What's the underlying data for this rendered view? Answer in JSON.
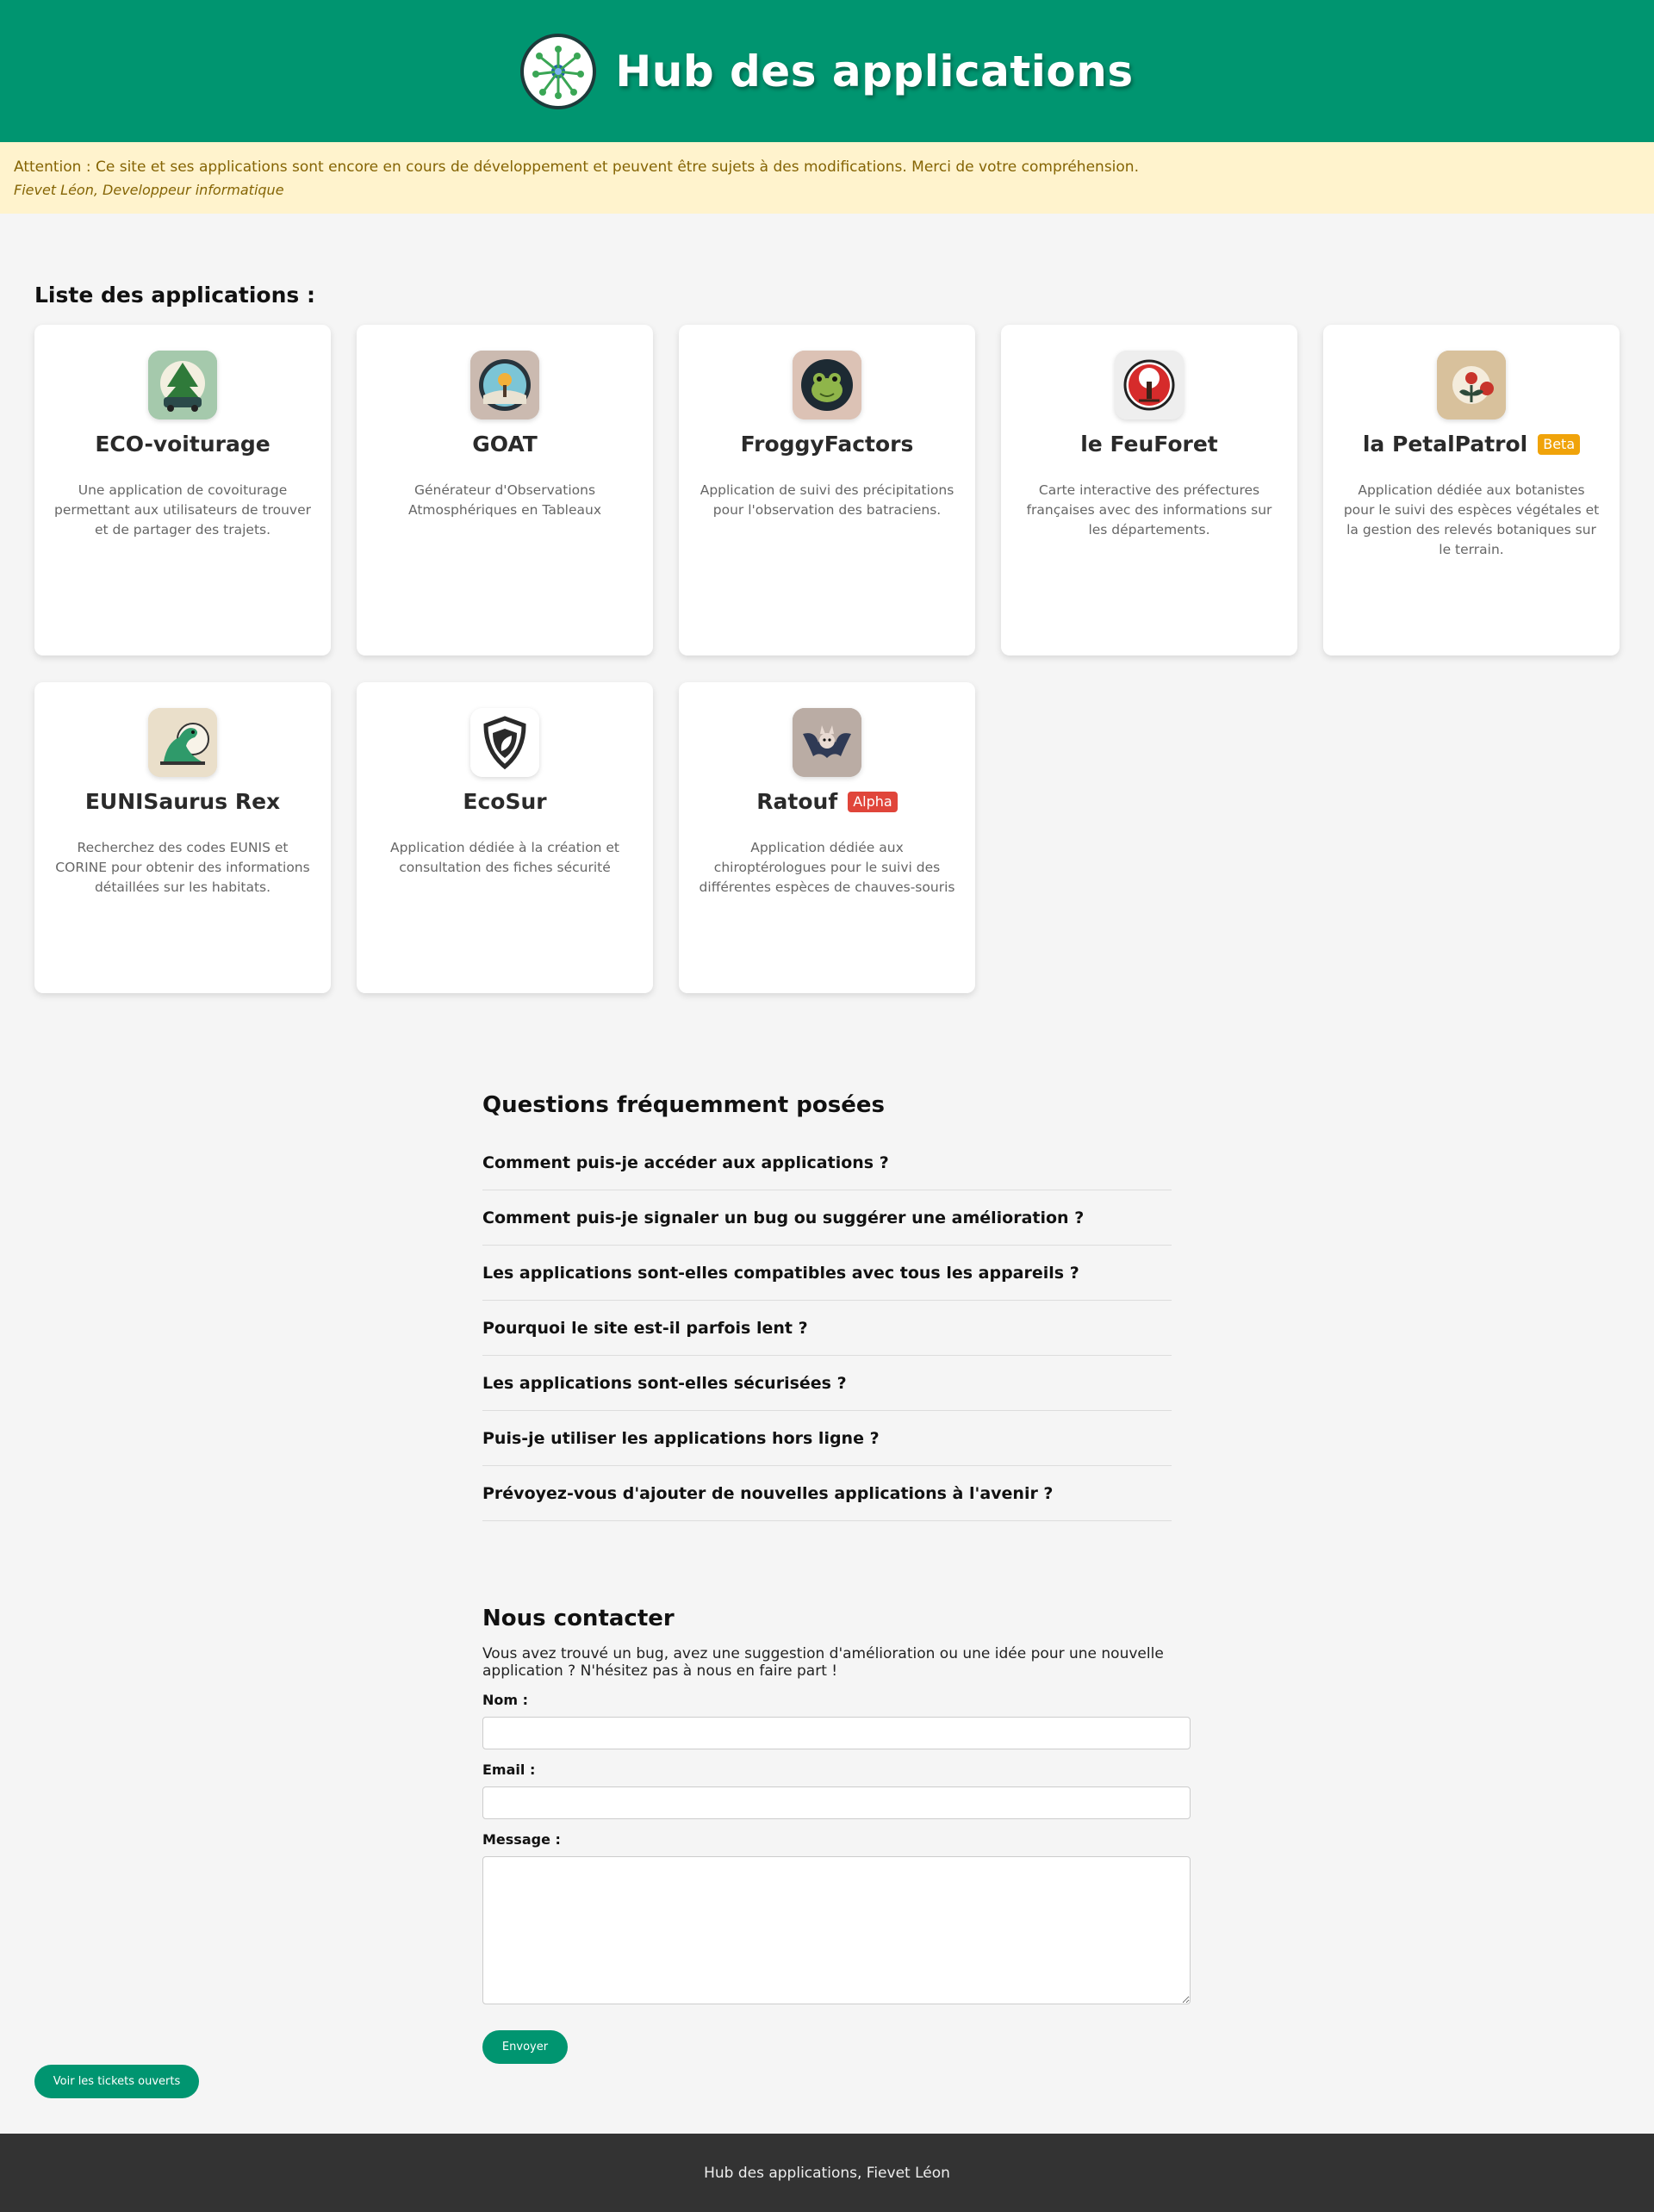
{
  "header": {
    "title": "Hub des applications",
    "logo_icon": "network-tree-icon"
  },
  "notice": {
    "message": "Attention : Ce site et ses applications sont encore en cours de développement et peuvent être sujets à des modifications. Merci de votre compréhension.",
    "signature": "Fievet Léon, Developpeur informatique"
  },
  "apps": {
    "section_title": "Liste des applications :",
    "items": [
      {
        "name": "ECO-voiturage",
        "description": "Une application de covoiturage permettant aux utilisateurs de trouver et de partager des trajets.",
        "icon": "tree-car-icon",
        "badge": ""
      },
      {
        "name": "GOAT",
        "description": "Générateur d'Observations Atmosphériques en Tableaux",
        "icon": "weather-landscape-icon",
        "badge": ""
      },
      {
        "name": "FroggyFactors",
        "description": "Application de suivi des précipitations pour l'observation des batraciens.",
        "icon": "frog-icon",
        "badge": ""
      },
      {
        "name": "le FeuForet",
        "description": "Carte interactive des préfectures françaises avec des informations sur les départements.",
        "icon": "red-tree-icon",
        "badge": ""
      },
      {
        "name": "la PetalPatrol",
        "description": "Application dédiée aux botanistes pour le suivi des espèces végétales et la gestion des relevés botaniques sur le terrain.",
        "icon": "flower-icon",
        "badge": "Beta"
      },
      {
        "name": "EUNISaurus Rex",
        "description": "Recherchez des codes EUNIS et CORINE pour obtenir des informations détaillées sur les habitats.",
        "icon": "dinosaur-icon",
        "badge": ""
      },
      {
        "name": "EcoSur",
        "description": "Application dédiée à la création et consultation des fiches sécurité",
        "icon": "shield-leaf-icon",
        "badge": ""
      },
      {
        "name": "Ratouf",
        "description": "Application dédiée aux chiroptérologues pour le suivi des différentes espèces de chauves-souris",
        "icon": "bat-icon",
        "badge": "Alpha"
      }
    ]
  },
  "faq": {
    "title": "Questions fréquemment posées",
    "items": [
      "Comment puis-je accéder aux applications ?",
      "Comment puis-je signaler un bug ou suggérer une amélioration ?",
      "Les applications sont-elles compatibles avec tous les appareils ?",
      "Pourquoi le site est-il parfois lent ?",
      "Les applications sont-elles sécurisées ?",
      "Puis-je utiliser les applications hors ligne ?",
      "Prévoyez-vous d'ajouter de nouvelles applications à l'avenir ?"
    ]
  },
  "contact": {
    "title": "Nous contacter",
    "intro": "Vous avez trouvé un bug, avez une suggestion d'amélioration ou une idée pour une nouvelle application ? N'hésitez pas à nous en faire part !",
    "name_label": "Nom :",
    "name_value": "",
    "email_label": "Email :",
    "email_value": "",
    "message_label": "Message :",
    "message_value": "",
    "submit_label": "Envoyer"
  },
  "tickets_button": "Voir les tickets ouverts",
  "footer": {
    "text": "Hub des applications, Fievet Léon"
  },
  "colors": {
    "brand": "#009570",
    "notice_bg": "#fff3cd",
    "notice_text": "#856404",
    "beta": "#f0a30a",
    "alpha": "#e0453a",
    "footer_bg": "#333333"
  }
}
